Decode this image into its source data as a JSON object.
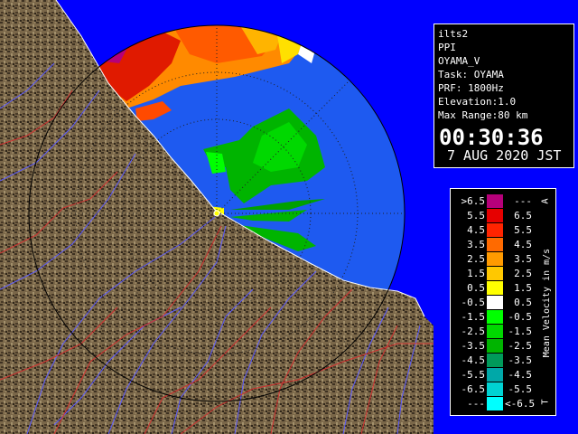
{
  "info": {
    "lines": [
      "ilts2",
      "PPI",
      "OYAMA_V",
      "Task: OYAMA",
      "PRF: 1800Hz",
      "Elevation:1.0",
      "Max Range:80 km"
    ],
    "time": "00:30:36",
    "date": "7 AUG 2020 JST"
  },
  "legend": {
    "title": "Mean Velocity in m/s",
    "top_mark": "A",
    "bottom_mark": "T",
    "rows": [
      {
        "left": ">6.5",
        "right": "---",
        "color": "#b6007a"
      },
      {
        "left": "5.5",
        "right": "6.5",
        "color": "#e60000"
      },
      {
        "left": "4.5",
        "right": "5.5",
        "color": "#ff2400"
      },
      {
        "left": "3.5",
        "right": "4.5",
        "color": "#ff6a00"
      },
      {
        "left": "2.5",
        "right": "3.5",
        "color": "#ff9a00"
      },
      {
        "left": "1.5",
        "right": "2.5",
        "color": "#ffc800"
      },
      {
        "left": "0.5",
        "right": "1.5",
        "color": "#ffff00"
      },
      {
        "left": "-0.5",
        "right": "0.5",
        "color": "#ffffff"
      },
      {
        "left": "-1.5",
        "right": "-0.5",
        "color": "#00ff00"
      },
      {
        "left": "-2.5",
        "right": "-1.5",
        "color": "#00d800"
      },
      {
        "left": "-3.5",
        "right": "-2.5",
        "color": "#00b400"
      },
      {
        "left": "-4.5",
        "right": "-3.5",
        "color": "#009a5a"
      },
      {
        "left": "-5.5",
        "right": "-4.5",
        "color": "#00a8a8"
      },
      {
        "left": "-6.5",
        "right": "-5.5",
        "color": "#00d2d2"
      },
      {
        "left": "---",
        "right": "<-6.5",
        "color": "#00ffff"
      }
    ]
  },
  "colors": {
    "scan_bg": "#1e5af0",
    "sea_outside": "#0000ff",
    "land": "#7d6a4e",
    "land_dark": "#3f3222",
    "range_ring": "#ffffff",
    "rivers": "#5050ff",
    "boundaries": "#d03030"
  }
}
